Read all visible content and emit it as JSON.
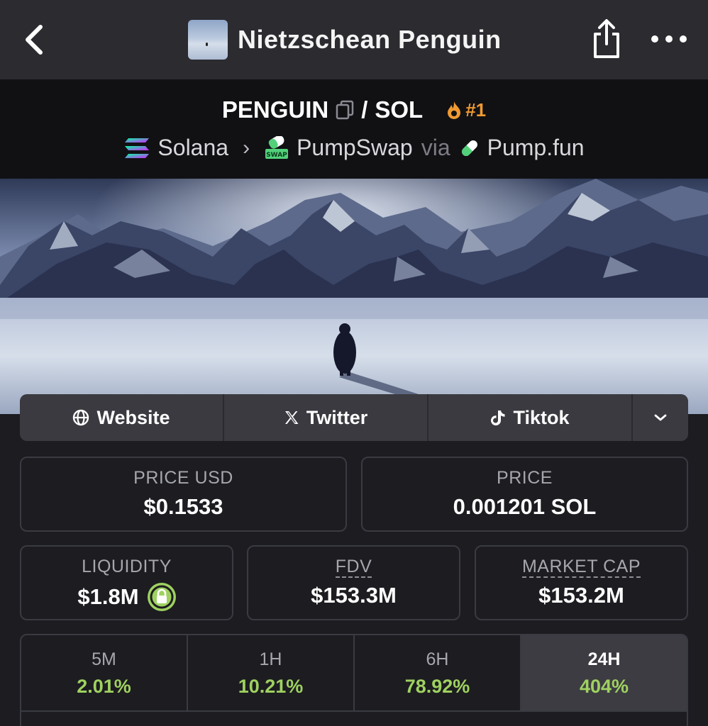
{
  "nav": {
    "title": "Nietzschean Penguin",
    "back_icon": "chevron-left-icon",
    "share_icon": "share-icon",
    "more_icon": "more-horizontal-icon"
  },
  "pair": {
    "base": "PENGUIN",
    "slash": "/",
    "quote": "SOL",
    "rank": "#1",
    "rank_color": "#f09a32"
  },
  "chain": {
    "network": "Solana",
    "dex": "PumpSwap",
    "via": "via",
    "launchpad": "Pump.fun",
    "dex_badge": "SWAP"
  },
  "socials": {
    "website": "Website",
    "twitter": "Twitter",
    "tiktok": "Tiktok"
  },
  "stats": {
    "price_usd_label": "PRICE USD",
    "price_usd": "$0.1533",
    "price_label": "PRICE",
    "price": "0.001201 SOL",
    "liquidity_label": "LIQUIDITY",
    "liquidity": "$1.8M",
    "fdv_label": "FDV",
    "fdv": "$153.3M",
    "mcap_label": "MARKET CAP",
    "mcap": "$153.2M"
  },
  "timeframes": [
    {
      "label": "5M",
      "value": "2.01%"
    },
    {
      "label": "1H",
      "value": "10.21%"
    },
    {
      "label": "6H",
      "value": "78.92%"
    },
    {
      "label": "24H",
      "value": "404%"
    }
  ],
  "colors": {
    "positive": "#9fd160",
    "background": "#1c1c21",
    "topbar": "#2b2b30"
  }
}
